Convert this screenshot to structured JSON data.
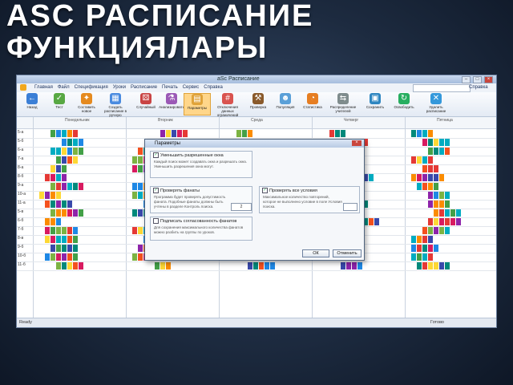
{
  "slide": {
    "title": "ASC РАСПИСАНИЕ ФУНКЦИЯЛАРЫ"
  },
  "window": {
    "title": "aSc Расписание"
  },
  "menu": {
    "items": [
      "Главная",
      "Файл",
      "Спецификация",
      "Уроки",
      "Расписание",
      "Печать",
      "Сервис",
      "Справка"
    ],
    "help": "Справка"
  },
  "ribbon": {
    "buttons": [
      {
        "label": "Назад",
        "icon": "back-arrow-icon",
        "color": "#3b7fd6"
      },
      {
        "label": "Тест",
        "icon": "check-icon",
        "color": "#58a843"
      },
      {
        "label": "Составить новое",
        "icon": "wand-icon",
        "color": "#e58a1f"
      },
      {
        "label": "Создать расписание в ручную",
        "icon": "grid-icon",
        "color": "#4a8be0"
      },
      {
        "label": "Случайный",
        "icon": "dice-icon",
        "color": "#c94444"
      },
      {
        "label": "Анализировать",
        "icon": "flask-icon",
        "color": "#9b59b6"
      },
      {
        "label": "Параметры",
        "icon": "params-icon",
        "color": "#e0a33a"
      },
      {
        "label": "Отключения данных ограничений",
        "icon": "hash-icon",
        "color": "#d9534f"
      },
      {
        "label": "Проверка",
        "icon": "gavel-icon",
        "color": "#8a5a2b"
      },
      {
        "label": "Популяция",
        "icon": "population-icon",
        "color": "#5aa0d8"
      },
      {
        "label": "Статистика",
        "icon": "pie-chart-icon",
        "color": "#e67e22"
      },
      {
        "label": "Распределение учителей",
        "icon": "distribute-icon",
        "color": "#7f8c8d"
      },
      {
        "label": "Сохранить",
        "icon": "save-icon",
        "color": "#2e86c1"
      },
      {
        "label": "Освободить",
        "icon": "release-icon",
        "color": "#27ae60"
      },
      {
        "label": "Удалить расписание",
        "icon": "trash-icon",
        "color": "#3498db"
      }
    ]
  },
  "grid": {
    "days": [
      "Понедельник",
      "Вторник",
      "Среда",
      "Четверг",
      "Пятница"
    ],
    "rows": [
      "5-а",
      "5-б",
      "6-а",
      "7-а",
      "8-а",
      "8-б",
      "9-а",
      "10-а",
      "11-а",
      "5-в",
      "6-б",
      "7-б",
      "8-в",
      "9-б",
      "10-б",
      "11-б"
    ],
    "palette": [
      "#e53935",
      "#43a047",
      "#1e88e5",
      "#fdd835",
      "#8e24aa",
      "#00acc1",
      "#fb8c00",
      "#d81b60",
      "#7cb342",
      "#3949ab",
      "#f4511e",
      "#00897b"
    ]
  },
  "dialog": {
    "title": "Параметры",
    "group1": {
      "label": "Уменьшить разрешенные окна",
      "desc": "Каждый поиск может создавать окна и разрешать окна. Уменьшить разрешения окна могут."
    },
    "group2": {
      "label": "Проверять фанаты",
      "desc": "Программа будет проверять допустимость фаната. Подобные фанаты должны быть учтены в разделе Контроль поиска.",
      "value": "2"
    },
    "group3": {
      "label": "Проверять все условия",
      "desc": "Максимальное количество повторений, которое не выполнено условие в поле Условия поиска.",
      "value": ""
    },
    "group4": {
      "label": "Подписать согласованность фанатов",
      "desc": "Для сохранения максимального количества фанатов можно разбить на группы по уроков."
    },
    "ok": "ОК",
    "cancel": "Отменить"
  },
  "status": {
    "left": "Ready",
    "right": "Готово"
  }
}
